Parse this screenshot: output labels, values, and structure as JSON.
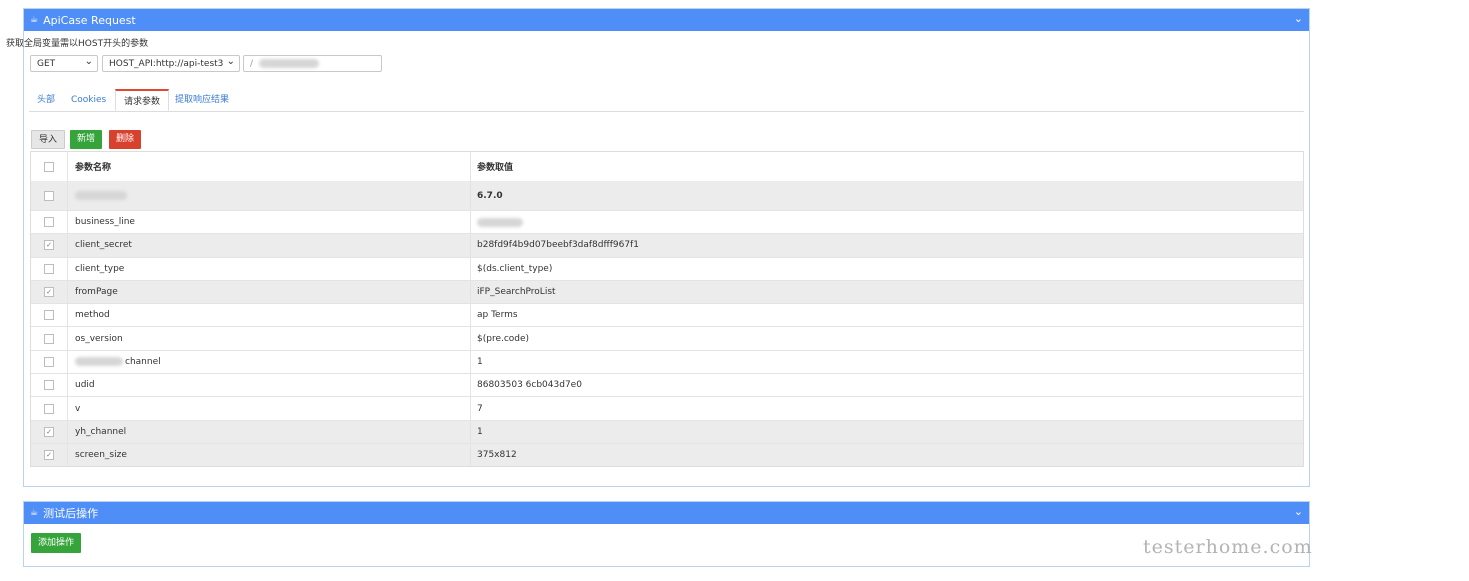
{
  "panel1": {
    "title": "ApiCase Request",
    "icon": "coffee-icon"
  },
  "hint": "获取全局变量需以HOST开头的参数",
  "method_select": "GET",
  "host_select": "HOST_API:http://api-test3",
  "path_input": "/",
  "tabs": [
    "头部",
    "Cookies",
    "请求参数",
    "提取响应结果"
  ],
  "active_tab": "请求参数",
  "buttons": {
    "import": "导入",
    "add": "新增",
    "delete": "删除"
  },
  "table": {
    "headers": [
      "参数名称",
      "参数取值"
    ],
    "rows": [
      {
        "name": "",
        "value": "6.7.0",
        "checked": false,
        "shade": true
      },
      {
        "name": "business_line",
        "value": "",
        "checked": false,
        "shade": false
      },
      {
        "name": "client_secret",
        "value": "b28fd9f4b9d07beebf3daf8dfff967f1",
        "checked": true,
        "shade": true
      },
      {
        "name": "client_type",
        "value": "$(ds.client_type)",
        "checked": false,
        "shade": false
      },
      {
        "name": "fromPage",
        "value": "iFP_SearchProList",
        "checked": true,
        "shade": true
      },
      {
        "name": "method",
        "value": "ap Terms",
        "checked": false,
        "shade": false
      },
      {
        "name": "os_version",
        "value": "$(pre.code)",
        "checked": false,
        "shade": false
      },
      {
        "name": "channel",
        "value": "1",
        "checked": false,
        "shade": false
      },
      {
        "name": "udid",
        "value": "86803503 6cb043d7e0",
        "checked": false,
        "shade": false
      },
      {
        "name": "v",
        "value": "7",
        "checked": false,
        "shade": false
      },
      {
        "name": "yh_channel",
        "value": "1",
        "checked": true,
        "shade": true
      },
      {
        "name": "screen_size",
        "value": "375x812",
        "checked": true,
        "shade": true
      }
    ]
  },
  "panel2": {
    "title": "测试后操作",
    "add_button": "添加操作"
  },
  "watermark": "testerhome.com"
}
